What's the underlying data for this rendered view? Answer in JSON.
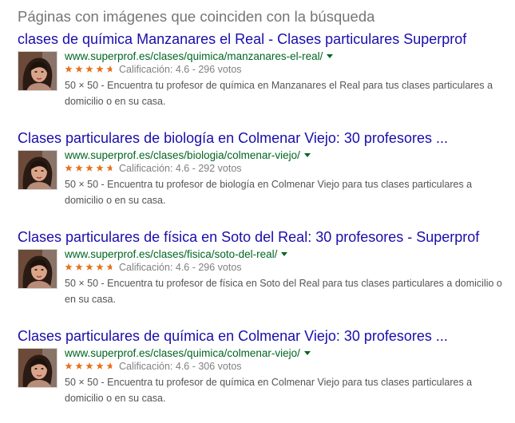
{
  "section_heading": "Páginas con imágenes que coinciden con la búsqueda",
  "colors": {
    "title_link": "#1a0dab",
    "url": "#006621",
    "star": "#e7711b",
    "snippet": "#545454",
    "heading": "#757575"
  },
  "results": [
    {
      "title": "clases de química Manzanares el Real - Clases particulares Superprof",
      "url": "www.superprof.es/clases/quimica/manzanares-el-real/",
      "rating_text": "Calificación: 4.6 - 296 votos",
      "rating": 4.6,
      "snippet": "50 × 50 - Encuentra tu profesor de química en Manzanares el Real para tus clases particulares a domicilio o en su casa.",
      "thumb_icon": "profile-photo-icon"
    },
    {
      "title": "Clases particulares de biología en Colmenar Viejo: 30 profesores ...",
      "url": "www.superprof.es/clases/biologia/colmenar-viejo/",
      "rating_text": "Calificación: 4.6 - 292 votos",
      "rating": 4.6,
      "snippet": "50 × 50 - Encuentra tu profesor de biología en Colmenar Viejo para tus clases particulares a domicilio o en su casa.",
      "thumb_icon": "profile-photo-icon"
    },
    {
      "title": "Clases particulares de física en Soto del Real: 30 profesores - Superprof",
      "url": "www.superprof.es/clases/fisica/soto-del-real/",
      "rating_text": "Calificación: 4.6 - 296 votos",
      "rating": 4.6,
      "snippet": "50 × 50 - Encuentra tu profesor de física en Soto del Real para tus clases particulares a domicilio o en su casa.",
      "thumb_icon": "profile-photo-icon"
    },
    {
      "title": "Clases particulares de química en Colmenar Viejo: 30 profesores ...",
      "url": "www.superprof.es/clases/quimica/colmenar-viejo/",
      "rating_text": "Calificación: 4.6 - 306 votos",
      "rating": 4.6,
      "snippet": "50 × 50 - Encuentra tu profesor de química en Colmenar Viejo para tus clases particulares a domicilio o en su casa.",
      "thumb_icon": "profile-photo-icon"
    }
  ]
}
